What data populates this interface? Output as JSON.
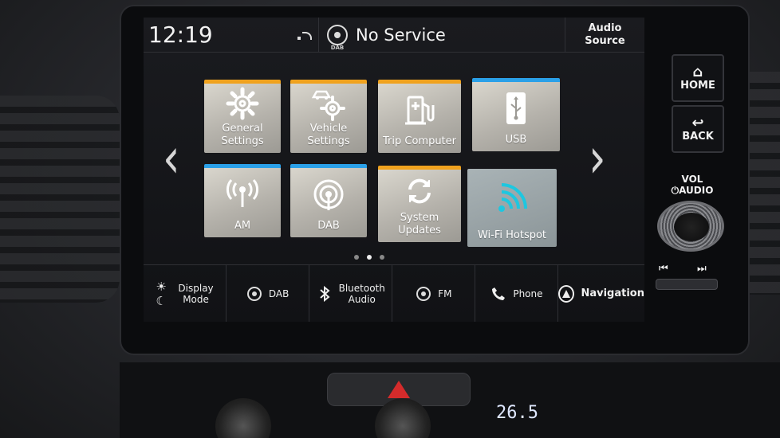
{
  "status": {
    "time": "12:19",
    "station": "No Service",
    "dab_badge": "DAB",
    "audio_source": "Audio\nSource"
  },
  "tiles": [
    {
      "label": "General\nSettings",
      "icon": "gear-icon",
      "accent": "#f0a21e"
    },
    {
      "label": "Vehicle\nSettings",
      "icon": "car-gear-icon",
      "accent": "#f0a21e"
    },
    {
      "label": "Trip Computer",
      "icon": "fuel-pump-icon",
      "accent": "#f0a21e"
    },
    {
      "label": "USB",
      "icon": "usb-icon",
      "accent": "#2aa0e8"
    },
    {
      "label": "AM",
      "icon": "am-antenna-icon",
      "accent": "#2aa0e8"
    },
    {
      "label": "DAB",
      "icon": "dab-icon",
      "accent": "#2aa0e8"
    },
    {
      "label": "System\nUpdates",
      "icon": "refresh-icon",
      "accent": "#f0a21e"
    },
    {
      "label": "Wi-Fi Hotspot",
      "icon": "wifi-icon",
      "accent": "#1ec7e0"
    }
  ],
  "nav": {
    "prev_arrow": "‹",
    "next_arrow": "›"
  },
  "bottom_bar": [
    {
      "label": "Display\nMode",
      "icon": "display-mode-icon"
    },
    {
      "label": "DAB",
      "icon": "dab-icon"
    },
    {
      "label": "Bluetooth\nAudio",
      "icon": "bluetooth-icon"
    },
    {
      "label": "FM",
      "icon": "fm-icon"
    },
    {
      "label": "Phone",
      "icon": "phone-icon"
    },
    {
      "label": "Navigation",
      "icon": "navigation-icon"
    }
  ],
  "hardware": {
    "home": "HOME",
    "back": "BACK",
    "vol": "VOL\n⏻AUDIO",
    "prev": "⏮",
    "next": "⏭"
  },
  "climate": {
    "temperature": "26.5"
  },
  "colors": {
    "accent_orange": "#f0a21e",
    "accent_blue": "#2aa0e8",
    "hotspot_cyan": "#1ec7e0",
    "hazard_red": "#d42b2b"
  }
}
